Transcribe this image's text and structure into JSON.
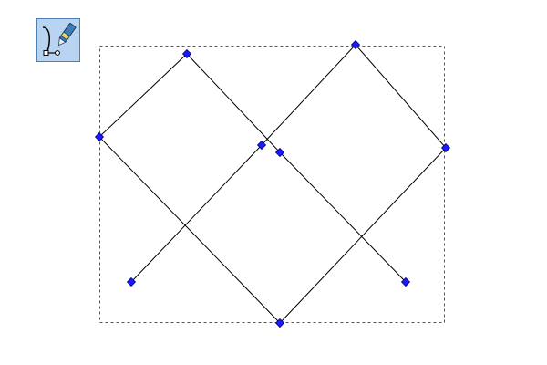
{
  "toolbar": {
    "active_tool_icon": "pen-bezier-icon"
  },
  "colors": {
    "node_fill": "#1a1aff",
    "node_stroke": "#000080",
    "path_stroke": "#000000",
    "bbox_stroke": "#555555",
    "tool_bg": "#b9d4f1",
    "tool_border": "#4d7fb8"
  },
  "selection": {
    "has_bounding_box": true,
    "bbox_style": "dashed"
  }
}
